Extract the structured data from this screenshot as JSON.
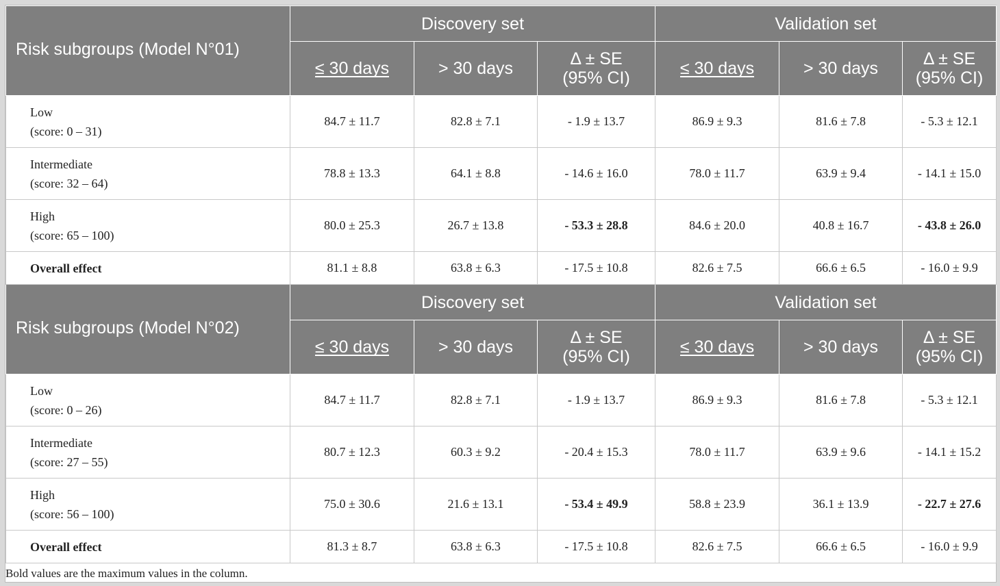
{
  "tables": [
    {
      "title": "Risk subgroups (Model N°01)",
      "group_headers": [
        "Discovery set",
        "Validation set"
      ],
      "col_headers": [
        "≤ 30 days",
        "> 30 days",
        "Δ ± SE",
        "(95% CI)"
      ],
      "rows": [
        {
          "label": "Low",
          "sublabel": "(score: 0 – 31)",
          "values": [
            "84.7 ± 11.7",
            "82.8 ± 7.1",
            "- 1.9 ± 13.7",
            "86.9 ± 9.3",
            "81.6 ± 7.8",
            "- 5.3 ± 12.1"
          ]
        },
        {
          "label": "Intermediate",
          "sublabel": "(score: 32 – 64)",
          "values": [
            "78.8 ± 13.3",
            "64.1 ± 8.8",
            "- 14.6 ± 16.0",
            "78.0 ± 11.7",
            "63.9 ± 9.4",
            "- 14.1 ± 15.0"
          ]
        },
        {
          "label": "High",
          "sublabel": "(score: 65 – 100)",
          "values": [
            "80.0 ± 25.3",
            "26.7 ± 13.8",
            "- 53.3 ± 28.8",
            "84.6 ± 20.0",
            "40.8 ± 16.7",
            "- 43.8 ± 26.0"
          ]
        },
        {
          "label": "Overall effect",
          "sublabel": "",
          "values": [
            "81.1 ± 8.8",
            "63.8 ± 6.3",
            "- 17.5 ± 10.8",
            "82.6 ± 7.5",
            "66.6 ± 6.5",
            "- 16.0 ± 9.9"
          ]
        }
      ]
    },
    {
      "title": "Risk subgroups (Model N°02)",
      "group_headers": [
        "Discovery set",
        "Validation set"
      ],
      "col_headers": [
        "≤ 30 days",
        "> 30 days",
        "Δ ± SE",
        "(95% CI)"
      ],
      "rows": [
        {
          "label": "Low",
          "sublabel": "(score: 0 – 26)",
          "values": [
            "84.7 ± 11.7",
            "82.8 ± 7.1",
            "- 1.9 ± 13.7",
            "86.9 ± 9.3",
            "81.6 ± 7.8",
            "- 5.3 ± 12.1"
          ]
        },
        {
          "label": "Intermediate",
          "sublabel": "(score: 27 – 55)",
          "values": [
            "80.7 ± 12.3",
            "60.3 ± 9.2",
            "- 20.4 ± 15.3",
            "78.0 ± 11.7",
            "63.9 ± 9.6",
            "- 14.1 ± 15.2"
          ]
        },
        {
          "label": "High",
          "sublabel": "(score: 56 – 100)",
          "values": [
            "75.0 ± 30.6",
            "21.6 ± 13.1",
            "- 53.4 ± 49.9",
            "58.8 ± 23.9",
            "36.1 ± 13.9",
            "- 22.7 ± 27.6"
          ]
        },
        {
          "label": "Overall effect",
          "sublabel": "",
          "values": [
            "81.3 ± 8.7",
            "63.8 ± 6.3",
            "- 17.5 ± 10.8",
            "82.6 ± 7.5",
            "66.6 ± 6.5",
            "- 16.0 ± 9.9"
          ]
        }
      ]
    }
  ],
  "footnote": "Bold values are the maximum values in the column.",
  "colors": {
    "header_bg": "#7f7f7f",
    "header_text": "#ffffff",
    "page_bg": "#d9d9d9"
  }
}
